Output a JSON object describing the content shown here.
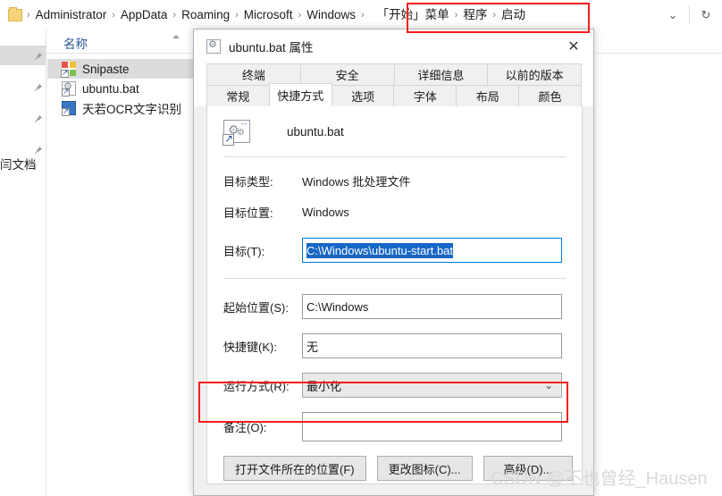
{
  "address_bar": {
    "breadcrumbs": [
      "Administrator",
      "AppData",
      "Roaming",
      "Microsoft",
      "Windows"
    ],
    "highlighted_breadcrumbs": [
      "「开始」菜单",
      "程序",
      "启动"
    ],
    "separator": "›",
    "dropdown_icon": "chevron-down-icon",
    "refresh_icon": "refresh-icon",
    "refresh_glyph": "↻",
    "chevron_glyph": "⌄"
  },
  "nav_pane": {
    "partial_label": "闫文档",
    "pin_glyph": "📌",
    "pin_count": 4
  },
  "file_list": {
    "column_header": "名称",
    "sort_direction": "ascending",
    "items": [
      {
        "name": "Snipaste",
        "icon": "snipaste-icon",
        "selected": true
      },
      {
        "name": "ubuntu.bat",
        "icon": "batch-shortcut-icon",
        "selected": false
      },
      {
        "name": "天若OCR文字识别",
        "icon": "ocr-shortcut-icon",
        "selected": false
      }
    ]
  },
  "dialog": {
    "title": "ubuntu.bat 属性",
    "title_icon": "batch-shortcut-icon",
    "close_glyph": "✕",
    "tab_row_1": [
      "终端",
      "安全",
      "详细信息",
      "以前的版本"
    ],
    "tab_row_2": [
      "常规",
      "快捷方式",
      "选项",
      "字体",
      "布局",
      "颜色"
    ],
    "active_tab": "快捷方式",
    "shortcut_name": "ubuntu.bat",
    "shortcut_icon": "batch-shortcut-icon",
    "fields": {
      "target_type_label": "目标类型:",
      "target_type_value": "Windows 批处理文件",
      "target_location_label": "目标位置:",
      "target_location_value": "Windows",
      "target_label": "目标(T):",
      "target_value": "C:\\Windows\\ubuntu-start.bat",
      "start_in_label": "起始位置(S):",
      "start_in_value": "C:\\Windows",
      "shortcut_key_label": "快捷键(K):",
      "shortcut_key_value": "无",
      "run_label": "运行方式(R):",
      "run_value": "最小化",
      "run_chevron": "⌄",
      "comment_label": "备注(O):",
      "comment_value": ""
    },
    "buttons": {
      "open_location": "打开文件所在的位置(F)",
      "change_icon": "更改图标(C)...",
      "advanced": "高级(D)..."
    }
  },
  "watermark": "CSDN @不也曾经_Hausen",
  "colors": {
    "annotation_red": "#f41d1d",
    "selection_blue": "#1667c6",
    "focus_blue": "#0078d7",
    "header_link": "#2a5699",
    "row_selected": "#dcdcdc"
  }
}
